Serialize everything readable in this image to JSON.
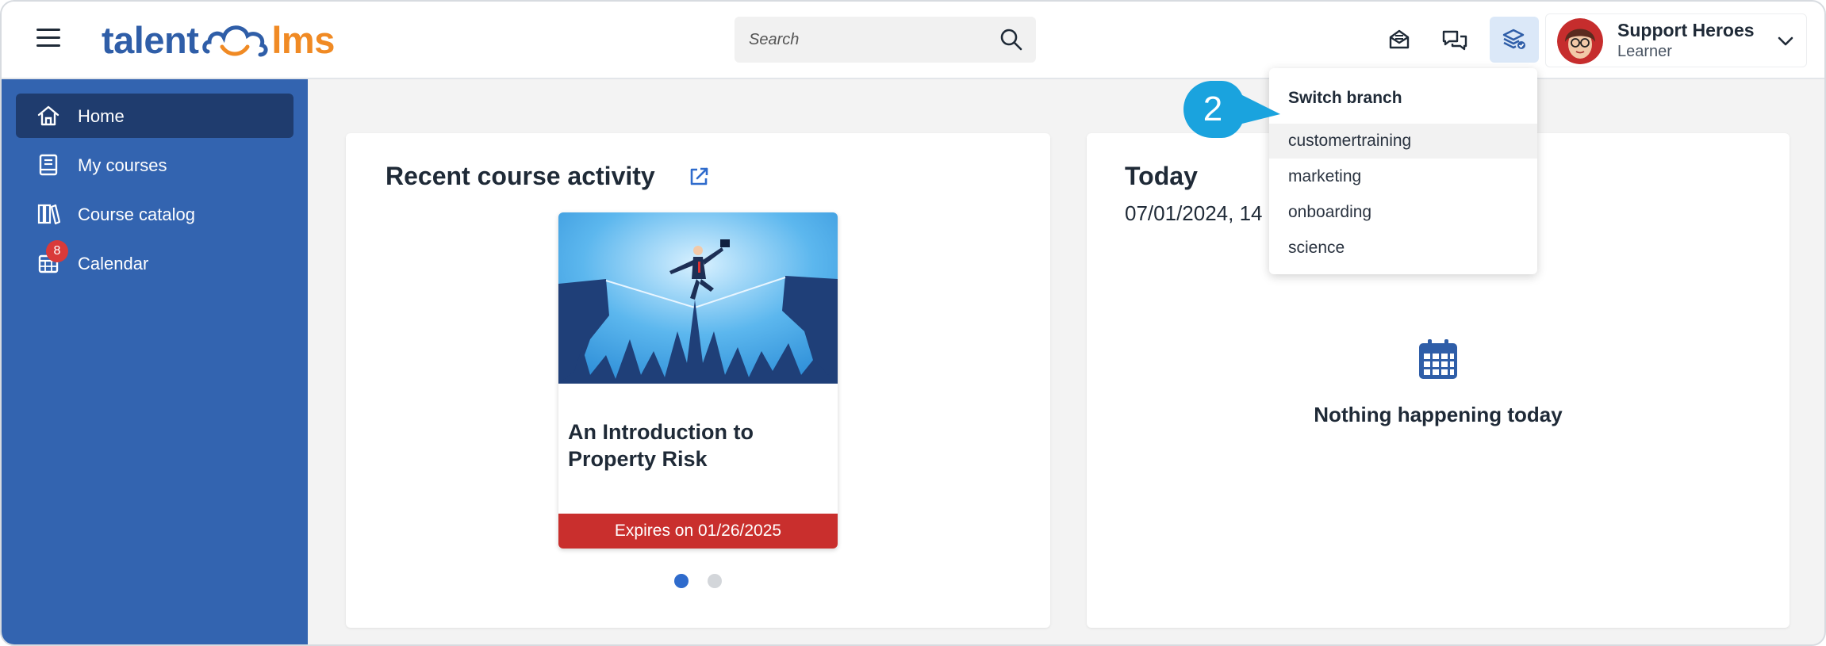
{
  "header": {
    "logo": {
      "part1": "talent",
      "part2": "lms"
    },
    "search": {
      "placeholder": "Search"
    },
    "user": {
      "name": "Support Heroes",
      "role": "Learner"
    }
  },
  "sidebar": {
    "items": [
      {
        "label": "Home",
        "icon": "home-icon",
        "active": true
      },
      {
        "label": "My courses",
        "icon": "book-icon"
      },
      {
        "label": "Course catalog",
        "icon": "catalog-icon"
      },
      {
        "label": "Calendar",
        "icon": "calendar-icon",
        "badge": "8"
      }
    ]
  },
  "recent": {
    "title": "Recent course activity",
    "course": {
      "title": "An Introduction to Property Risk",
      "expires": "Expires on 01/26/2025"
    }
  },
  "today": {
    "title": "Today",
    "date": "07/01/2024, 14",
    "empty": "Nothing happening today"
  },
  "branch_dropdown": {
    "title": "Switch branch",
    "items": [
      "customertraining",
      "marketing",
      "onboarding",
      "science"
    ]
  },
  "callout": {
    "step": "2"
  },
  "colors": {
    "brand_blue": "#3364b0",
    "brand_orange": "#f08a24",
    "sidebar_active": "#1f3c6e",
    "expire_red": "#c92f2d",
    "callout": "#1aa3de"
  }
}
